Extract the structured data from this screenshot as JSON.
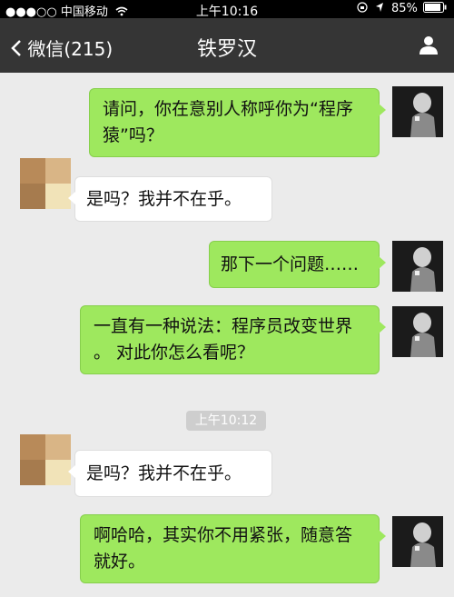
{
  "status": {
    "signal": "●●●○○",
    "carrier": "中国移动",
    "time": "上午10:16",
    "battery": "85%"
  },
  "nav": {
    "back_label": "微信(215)",
    "title": "铁罗汉"
  },
  "messages": [
    {
      "side": "out",
      "text": "请问，你在意别人称呼你为“程序猿”吗？"
    },
    {
      "side": "in",
      "text": "是吗？我并不在乎。"
    },
    {
      "side": "out",
      "text": "那下一个问题……"
    },
    {
      "side": "out",
      "text": "一直有一种说法：程序员改变世界 。 对此你怎么看呢？"
    },
    {
      "side": "in",
      "text": "是吗？我并不在乎。"
    },
    {
      "side": "out",
      "text": "啊哈哈，其实你不用紧张，随意答就好。"
    }
  ],
  "timestamp": "上午10:12",
  "icons": {
    "wifi": "wifi-icon",
    "lock_rotation": "lock-rotation-icon",
    "location": "location-icon",
    "battery": "battery-icon",
    "back": "back-chevron-icon",
    "contact": "contact-info-icon"
  },
  "colors": {
    "nav_bg": "#353535",
    "chat_bg": "#ebebeb",
    "outgoing_bubble": "#9ee85e",
    "incoming_bubble": "#ffffff"
  }
}
